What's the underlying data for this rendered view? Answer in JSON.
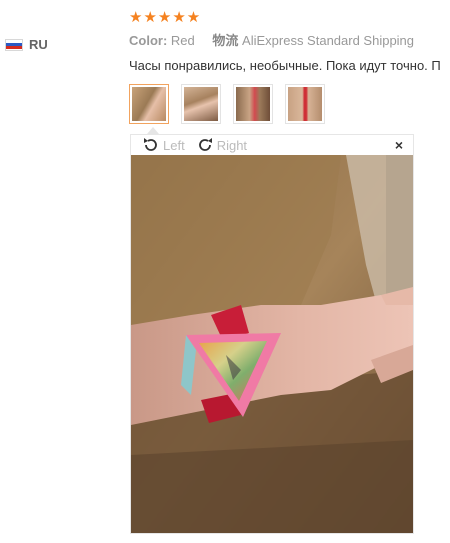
{
  "reviewer": {
    "country_code": "RU",
    "flag_colors": [
      "#ffffff",
      "#2b59c3",
      "#d52b1e"
    ]
  },
  "rating": {
    "stars": 5,
    "star_glyphs": "★★★★★",
    "color": "#f58220"
  },
  "meta": {
    "color_label": "Color:",
    "color_value": "Red",
    "shipping_label": "物流",
    "shipping_value": "AliExpress Standard Shipping"
  },
  "review_text": "Часы понравились, необычные. Пока идут точно. П",
  "thumbnails": [
    {
      "name": "photo-1",
      "selected": true
    },
    {
      "name": "photo-2",
      "selected": false
    },
    {
      "name": "photo-3",
      "selected": false
    },
    {
      "name": "photo-4",
      "selected": false
    }
  ],
  "viewer": {
    "rotate_left_label": "Left",
    "rotate_right_label": "Right",
    "close_glyph": "×",
    "rotate_left_icon": "rotate-left-icon",
    "rotate_right_icon": "rotate-right-icon"
  },
  "colors": {
    "accent": "#f58220",
    "selected_border": "#f2a35e"
  }
}
